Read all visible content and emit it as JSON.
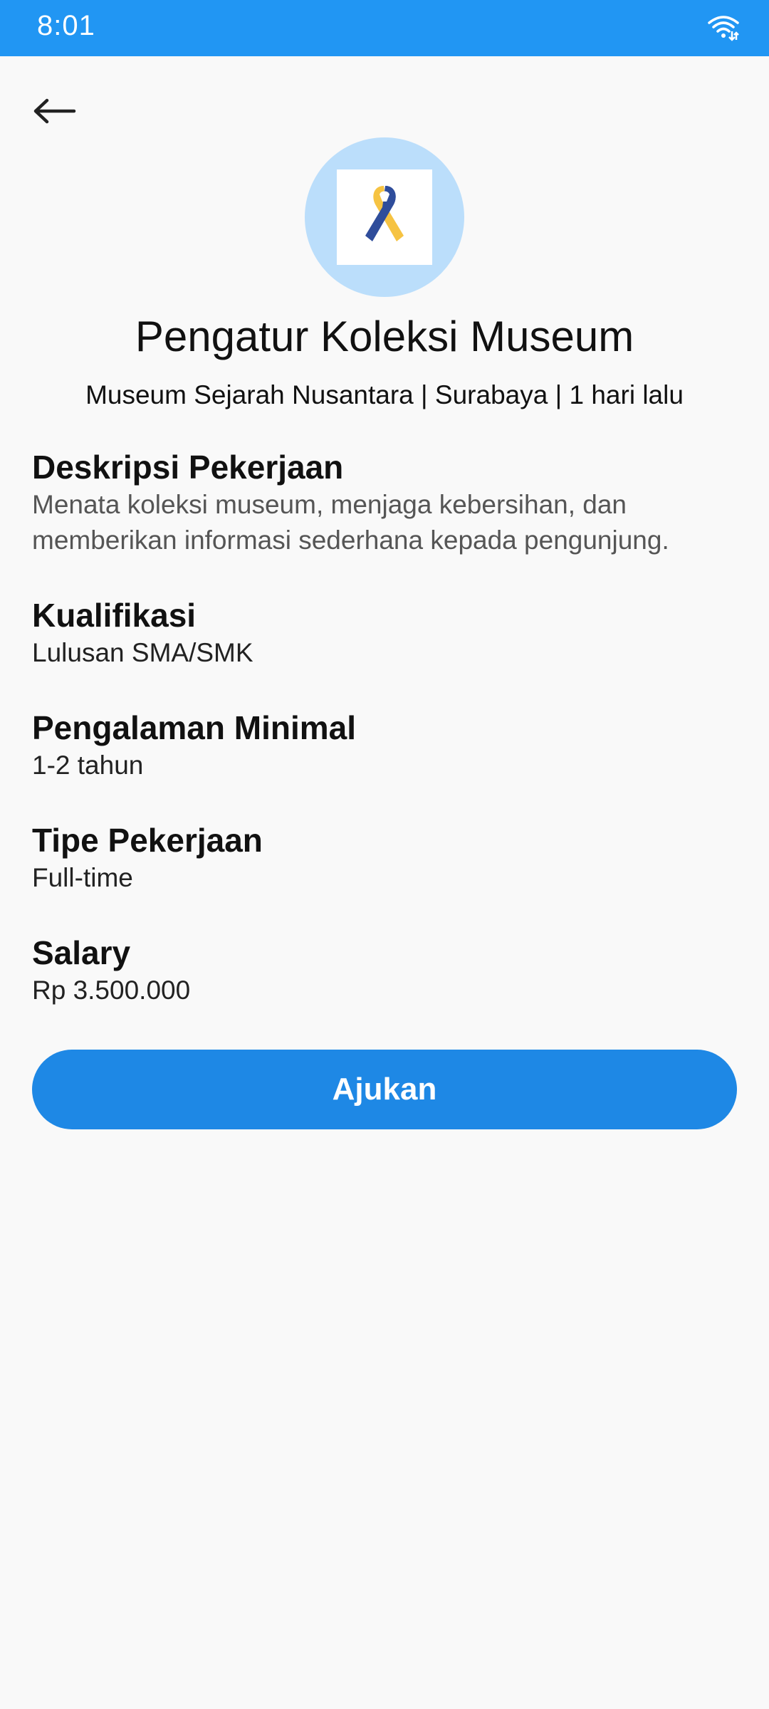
{
  "status_bar": {
    "time": "8:01",
    "icons": [
      "wifi-icon"
    ]
  },
  "header": {
    "back_icon": "arrow-left-icon"
  },
  "company": {
    "logo_icon": "awareness-ribbon-icon",
    "colors": {
      "circle": "#bbdefb",
      "ribbon_blue": "#2f4d9b",
      "ribbon_yellow": "#f6c342"
    }
  },
  "job": {
    "title": "Pengatur Koleksi Museum",
    "meta": "Museum Sejarah Nusantara | Surabaya | 1 hari lalu"
  },
  "sections": {
    "description": {
      "heading": "Deskripsi Pekerjaan",
      "text": "Menata koleksi museum, menjaga kebersihan, dan memberikan informasi sederhana kepada pengunjung."
    },
    "qualification": {
      "heading": "Kualifikasi",
      "text": "Lulusan SMA/SMK"
    },
    "experience": {
      "heading": "Pengalaman Minimal",
      "text": "1-2 tahun"
    },
    "job_type": {
      "heading": "Tipe Pekerjaan",
      "text": "Full-time"
    },
    "salary": {
      "heading": "Salary",
      "text": "Rp 3.500.000"
    }
  },
  "actions": {
    "apply_label": "Ajukan"
  },
  "theme": {
    "primary": "#2196f3",
    "button": "#1e88e5",
    "background": "#f9f9f9"
  }
}
